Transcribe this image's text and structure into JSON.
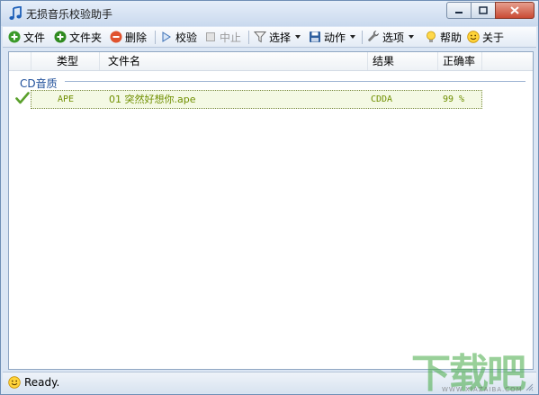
{
  "window": {
    "title": "无损音乐校验助手"
  },
  "toolbar": {
    "file": "文件",
    "folder": "文件夹",
    "delete": "删除",
    "verify": "校验",
    "stop": "中止",
    "select": "选择",
    "action": "动作",
    "options": "选项",
    "help": "帮助",
    "about": "关于"
  },
  "list": {
    "columns": [
      "类型",
      "文件名",
      "结果",
      "正确率"
    ],
    "group": "CD音质",
    "rows": [
      {
        "type": "APE",
        "filename": "01 突然好想你.ape",
        "result": "CDDA",
        "accuracy": "99 %"
      }
    ]
  },
  "status": {
    "text": "Ready."
  },
  "watermark": {
    "main": "下载吧",
    "sub": "WWW.XIAZAIBA.COM"
  },
  "colors": {
    "accent": "#1f4f9a",
    "row_text": "#6f8f00",
    "row_bg": "#f4f9e4"
  }
}
